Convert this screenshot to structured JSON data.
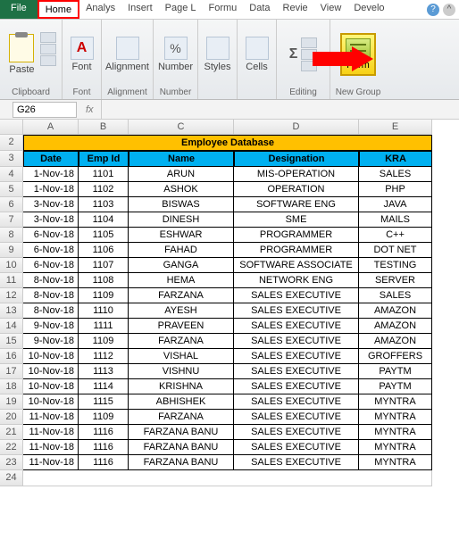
{
  "tabs": {
    "file": "File",
    "home": "Home",
    "list": [
      "Analys",
      "Insert",
      "Page L",
      "Formu",
      "Data",
      "Revie",
      "View",
      "Develo"
    ]
  },
  "ribbon": {
    "clipboard": {
      "label": "Clipboard",
      "paste": "Paste"
    },
    "font": {
      "label": "Font",
      "btn": "Font"
    },
    "alignment": {
      "label": "Alignment",
      "btn": "Alignment"
    },
    "number": {
      "label": "Number",
      "btn": "Number"
    },
    "styles": {
      "btn": "Styles"
    },
    "cells": {
      "btn": "Cells"
    },
    "editing": {
      "label": "Editing"
    },
    "newgroup": {
      "label": "New Group",
      "form": "Form"
    }
  },
  "namebox": "G26",
  "fx": "fx",
  "columns": [
    "A",
    "B",
    "C",
    "D",
    "E"
  ],
  "title": "Employee Database",
  "headers": [
    "Date",
    "Emp Id",
    "Name",
    "Designation",
    "KRA"
  ],
  "rows": [
    {
      "n": 4,
      "date": "1-Nov-18",
      "id": "1101",
      "name": "ARUN",
      "desig": "MIS-OPERATION",
      "kra": "SALES"
    },
    {
      "n": 5,
      "date": "1-Nov-18",
      "id": "1102",
      "name": "ASHOK",
      "desig": "OPERATION",
      "kra": "PHP"
    },
    {
      "n": 6,
      "date": "3-Nov-18",
      "id": "1103",
      "name": "BISWAS",
      "desig": "SOFTWARE ENG",
      "kra": "JAVA"
    },
    {
      "n": 7,
      "date": "3-Nov-18",
      "id": "1104",
      "name": "DINESH",
      "desig": "SME",
      "kra": "MAILS"
    },
    {
      "n": 8,
      "date": "6-Nov-18",
      "id": "1105",
      "name": "ESHWAR",
      "desig": "PROGRAMMER",
      "kra": "C++"
    },
    {
      "n": 9,
      "date": "6-Nov-18",
      "id": "1106",
      "name": "FAHAD",
      "desig": "PROGRAMMER",
      "kra": "DOT NET"
    },
    {
      "n": 10,
      "date": "6-Nov-18",
      "id": "1107",
      "name": "GANGA",
      "desig": "SOFTWARE ASSOCIATE",
      "kra": "TESTING"
    },
    {
      "n": 11,
      "date": "8-Nov-18",
      "id": "1108",
      "name": "HEMA",
      "desig": "NETWORK ENG",
      "kra": "SERVER"
    },
    {
      "n": 12,
      "date": "8-Nov-18",
      "id": "1109",
      "name": "FARZANA",
      "desig": "SALES EXECUTIVE",
      "kra": "SALES"
    },
    {
      "n": 13,
      "date": "8-Nov-18",
      "id": "1110",
      "name": "AYESH",
      "desig": "SALES EXECUTIVE",
      "kra": "AMAZON"
    },
    {
      "n": 14,
      "date": "9-Nov-18",
      "id": "1111",
      "name": "PRAVEEN",
      "desig": "SALES EXECUTIVE",
      "kra": "AMAZON"
    },
    {
      "n": 15,
      "date": "9-Nov-18",
      "id": "1109",
      "name": "FARZANA",
      "desig": "SALES EXECUTIVE",
      "kra": "AMAZON"
    },
    {
      "n": 16,
      "date": "10-Nov-18",
      "id": "1112",
      "name": "VISHAL",
      "desig": "SALES EXECUTIVE",
      "kra": "GROFFERS"
    },
    {
      "n": 17,
      "date": "10-Nov-18",
      "id": "1113",
      "name": "VISHNU",
      "desig": "SALES EXECUTIVE",
      "kra": "PAYTM"
    },
    {
      "n": 18,
      "date": "10-Nov-18",
      "id": "1114",
      "name": "KRISHNA",
      "desig": "SALES EXECUTIVE",
      "kra": "PAYTM"
    },
    {
      "n": 19,
      "date": "10-Nov-18",
      "id": "1115",
      "name": "ABHISHEK",
      "desig": "SALES EXECUTIVE",
      "kra": "MYNTRA"
    },
    {
      "n": 20,
      "date": "11-Nov-18",
      "id": "1109",
      "name": "FARZANA",
      "desig": "SALES EXECUTIVE",
      "kra": "MYNTRA"
    },
    {
      "n": 21,
      "date": "11-Nov-18",
      "id": "1116",
      "name": "FARZANA BANU",
      "desig": "SALES EXECUTIVE",
      "kra": "MYNTRA"
    },
    {
      "n": 22,
      "date": "11-Nov-18",
      "id": "1116",
      "name": "FARZANA BANU",
      "desig": "SALES EXECUTIVE",
      "kra": "MYNTRA"
    },
    {
      "n": 23,
      "date": "11-Nov-18",
      "id": "1116",
      "name": "FARZANA BANU",
      "desig": "SALES EXECUTIVE",
      "kra": "MYNTRA"
    }
  ]
}
